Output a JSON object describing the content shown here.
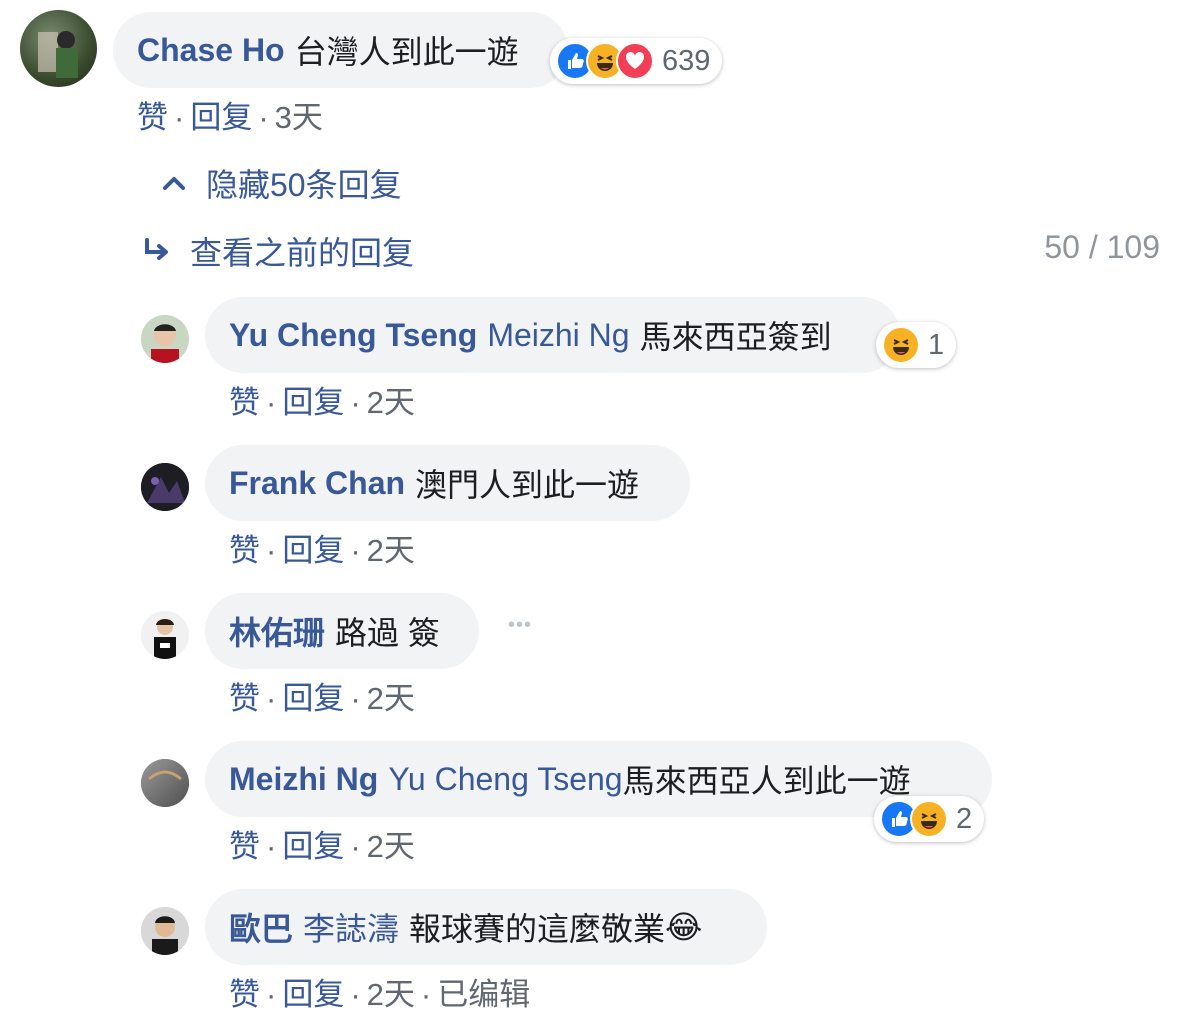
{
  "comment": {
    "name": "Chase Ho",
    "text": "台灣人到此一遊",
    "reaction_count": "639",
    "actions": {
      "like": "赞",
      "reply": "回复",
      "time": "3天"
    }
  },
  "replies_toggle": {
    "hide_label": "隐藏50条回复",
    "view_prev_label": "查看之前的回复",
    "counter": "50 / 109"
  },
  "replies": [
    {
      "name": "Yu Cheng Tseng",
      "mention": "Meizhi Ng",
      "text": "馬來西亞簽到",
      "reaction_count": "1",
      "like": "赞",
      "reply": "回复",
      "time": "2天"
    },
    {
      "name": "Frank Chan",
      "text": "澳門人到此一遊",
      "like": "赞",
      "reply": "回复",
      "time": "2天"
    },
    {
      "name": "林佑珊",
      "text": "路過 簽",
      "more": "•••",
      "like": "赞",
      "reply": "回复",
      "time": "2天"
    },
    {
      "name": "Meizhi Ng",
      "mention": "Yu Cheng Tseng",
      "text": "馬來西亞人到此一遊",
      "reaction_count": "2",
      "like": "赞",
      "reply": "回复",
      "time": "2天"
    },
    {
      "name": "歐巴",
      "mention": "李誌濤",
      "text": "報球賽的這麼敬業",
      "emoji": "😂",
      "like": "赞",
      "reply": "回复",
      "time": "2天",
      "edited": "已编辑"
    }
  ],
  "colors": {
    "link": "#385898",
    "bubble": "#f2f3f5",
    "like_blue": "#1877f2",
    "haha_yellow": "#f7b125",
    "love_red": "#f33e58"
  }
}
